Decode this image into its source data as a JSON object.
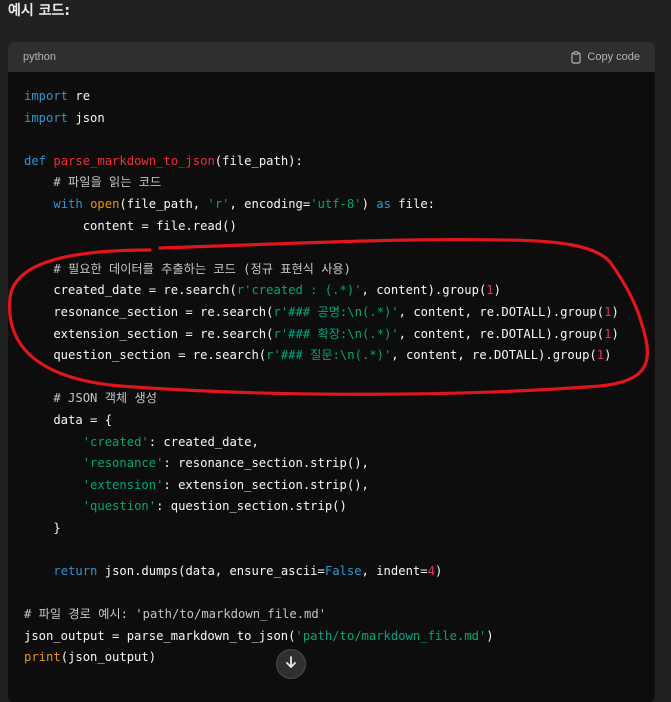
{
  "heading": "예시 코드:",
  "code_block": {
    "language": "python",
    "copy_label": "Copy code",
    "lines": [
      [
        {
          "t": "kw",
          "v": "import"
        },
        {
          "t": "",
          "v": " re"
        }
      ],
      [
        {
          "t": "kw",
          "v": "import"
        },
        {
          "t": "",
          "v": " json"
        }
      ],
      [],
      [
        {
          "t": "kw",
          "v": "def"
        },
        {
          "t": "",
          "v": " "
        },
        {
          "t": "fn",
          "v": "parse_markdown_to_json"
        },
        {
          "t": "",
          "v": "(file_path):"
        }
      ],
      [
        {
          "t": "",
          "v": "    "
        },
        {
          "t": "cm",
          "v": "# 파일을 읽는 코드"
        }
      ],
      [
        {
          "t": "",
          "v": "    "
        },
        {
          "t": "kw",
          "v": "with"
        },
        {
          "t": "",
          "v": " "
        },
        {
          "t": "bi",
          "v": "open"
        },
        {
          "t": "",
          "v": "(file_path, "
        },
        {
          "t": "str",
          "v": "'r'"
        },
        {
          "t": "",
          "v": ", encoding="
        },
        {
          "t": "str",
          "v": "'utf-8'"
        },
        {
          "t": "",
          "v": ") "
        },
        {
          "t": "kw",
          "v": "as"
        },
        {
          "t": "",
          "v": " file:"
        }
      ],
      [
        {
          "t": "",
          "v": "        content = file.read()"
        }
      ],
      [],
      [
        {
          "t": "",
          "v": "    "
        },
        {
          "t": "cm",
          "v": "# 필요한 데이터를 추출하는 코드 (정규 표현식 사용)"
        }
      ],
      [
        {
          "t": "",
          "v": "    created_date = re.search("
        },
        {
          "t": "str",
          "v": "r'created : (.*)'"
        },
        {
          "t": "",
          "v": ", content).group("
        },
        {
          "t": "num",
          "v": "1"
        },
        {
          "t": "",
          "v": ")"
        }
      ],
      [
        {
          "t": "",
          "v": "    resonance_section = re.search("
        },
        {
          "t": "str",
          "v": "r'### 공명:\\n(.*)'"
        },
        {
          "t": "",
          "v": ", content, re.DOTALL).group("
        },
        {
          "t": "num",
          "v": "1"
        },
        {
          "t": "",
          "v": ")"
        }
      ],
      [
        {
          "t": "",
          "v": "    extension_section = re.search("
        },
        {
          "t": "str",
          "v": "r'### 확장:\\n(.*)'"
        },
        {
          "t": "",
          "v": ", content, re.DOTALL).group("
        },
        {
          "t": "num",
          "v": "1"
        },
        {
          "t": "",
          "v": ")"
        }
      ],
      [
        {
          "t": "",
          "v": "    question_section = re.search("
        },
        {
          "t": "str",
          "v": "r'### 질문:\\n(.*)'"
        },
        {
          "t": "",
          "v": ", content, re.DOTALL).group("
        },
        {
          "t": "num",
          "v": "1"
        },
        {
          "t": "",
          "v": ")"
        }
      ],
      [],
      [
        {
          "t": "",
          "v": "    "
        },
        {
          "t": "cm",
          "v": "# JSON 객체 생성"
        }
      ],
      [
        {
          "t": "",
          "v": "    data = {"
        }
      ],
      [
        {
          "t": "",
          "v": "        "
        },
        {
          "t": "str",
          "v": "'created'"
        },
        {
          "t": "",
          "v": ": created_date,"
        }
      ],
      [
        {
          "t": "",
          "v": "        "
        },
        {
          "t": "str",
          "v": "'resonance'"
        },
        {
          "t": "",
          "v": ": resonance_section.strip(),"
        }
      ],
      [
        {
          "t": "",
          "v": "        "
        },
        {
          "t": "str",
          "v": "'extension'"
        },
        {
          "t": "",
          "v": ": extension_section.strip(),"
        }
      ],
      [
        {
          "t": "",
          "v": "        "
        },
        {
          "t": "str",
          "v": "'question'"
        },
        {
          "t": "",
          "v": ": question_section.strip()"
        }
      ],
      [
        {
          "t": "",
          "v": "    }"
        }
      ],
      [],
      [
        {
          "t": "",
          "v": "    "
        },
        {
          "t": "kw",
          "v": "return"
        },
        {
          "t": "",
          "v": " json.dumps(data, ensure_ascii="
        },
        {
          "t": "kw",
          "v": "False"
        },
        {
          "t": "",
          "v": ", indent="
        },
        {
          "t": "num",
          "v": "4"
        },
        {
          "t": "",
          "v": ")"
        }
      ],
      [],
      [
        {
          "t": "cm",
          "v": "# 파일 경로 예시: 'path/to/markdown_file.md'"
        }
      ],
      [
        {
          "t": "",
          "v": "json_output = parse_markdown_to_json("
        },
        {
          "t": "str",
          "v": "'path/to/markdown_file.md'"
        },
        {
          "t": "",
          "v": ")"
        }
      ],
      [
        {
          "t": "bi",
          "v": "print"
        },
        {
          "t": "",
          "v": "(json_output)"
        }
      ]
    ]
  },
  "annotation": {
    "color": "#e0161b"
  },
  "scroll_button": {
    "icon": "arrow-down-icon"
  }
}
